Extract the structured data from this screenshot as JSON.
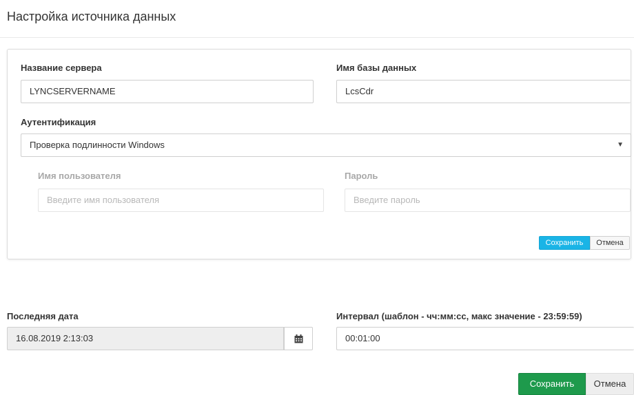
{
  "dialog": {
    "title": "Настройка источника данных"
  },
  "server": {
    "server_label": "Название сервера",
    "server_value": "LYNCSERVERNAME",
    "db_label": "Имя базы данных",
    "db_value": "LcsCdr",
    "auth_label": "Аутентификация",
    "auth_selected": "Проверка подлинности Windows",
    "username_label": "Имя пользователя",
    "username_placeholder": "Введите имя пользователя",
    "password_label": "Пароль",
    "password_placeholder": "Введите пароль",
    "save_label": "Сохранить",
    "cancel_label": "Отмена"
  },
  "schedule": {
    "last_date_label": "Последняя дата",
    "last_date_value": "16.08.2019 2:13:03",
    "interval_label": "Интервал (шаблон - чч:мм:сс, макс значение - 23:59:59)",
    "interval_value": "00:01:00"
  },
  "footer": {
    "save_label": "Сохранить",
    "cancel_label": "Отмена"
  },
  "icons": {
    "calendar": "calendar-icon",
    "dropdown": "caret-down-icon"
  },
  "colors": {
    "primary": "#1ab4e6",
    "success": "#1e9a4c"
  }
}
